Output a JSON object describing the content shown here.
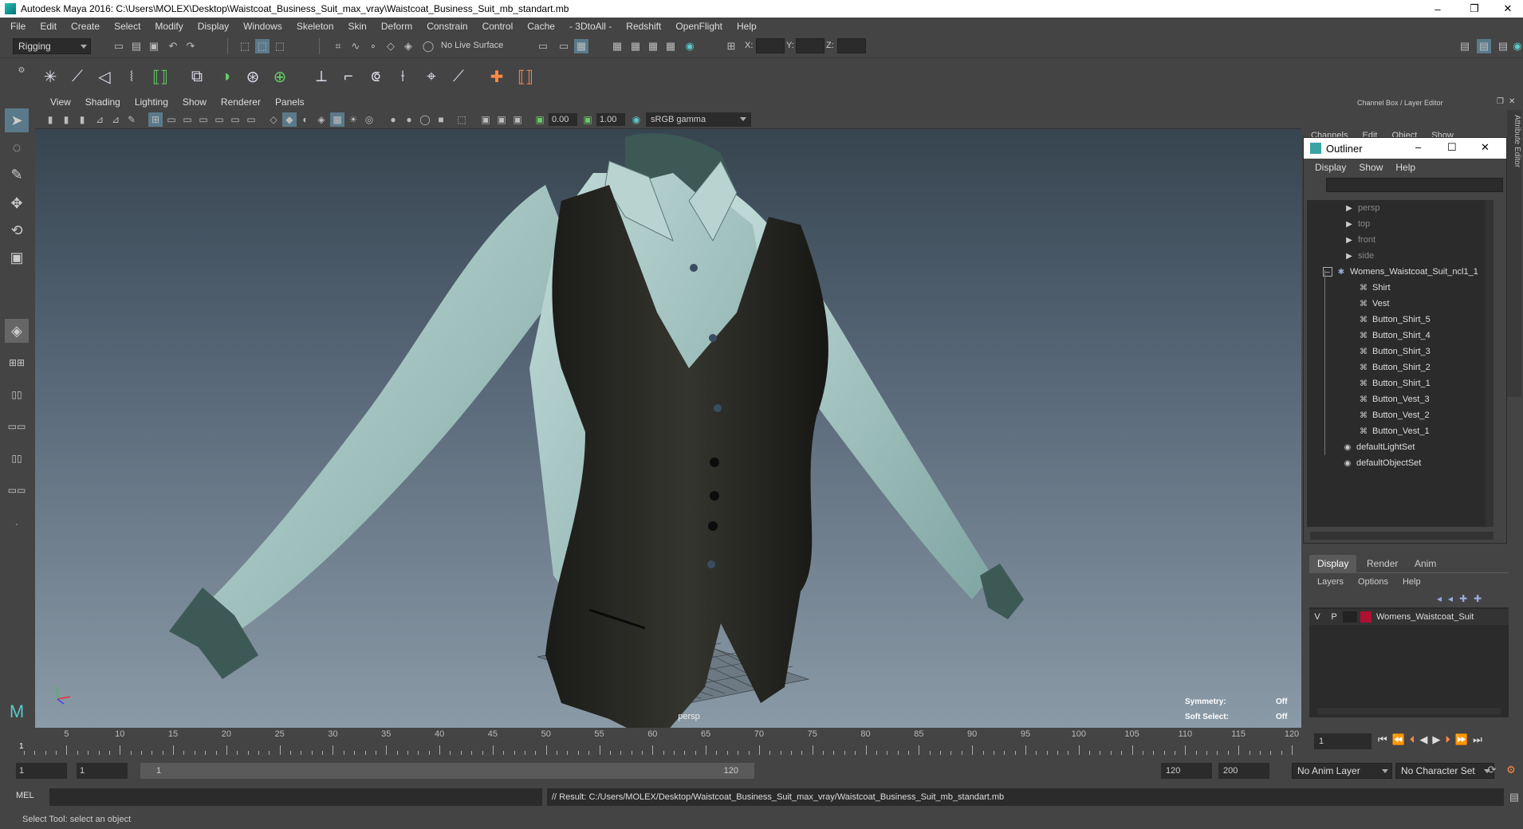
{
  "window": {
    "title": "Autodesk Maya 2016: C:\\Users\\MOLEX\\Desktop\\Waistcoat_Business_Suit_max_vray\\Waistcoat_Business_Suit_mb_standart.mb",
    "minimize": "–",
    "restore": "❐",
    "close": "✕"
  },
  "menubar": [
    "File",
    "Edit",
    "Create",
    "Select",
    "Modify",
    "Display",
    "Windows",
    "Skeleton",
    "Skin",
    "Deform",
    "Constrain",
    "Control",
    "Cache",
    "- 3DtoAll -",
    "Redshift",
    "OpenFlight",
    "Help"
  ],
  "status": {
    "menuset": "Rigging",
    "live_surface": "No Live Surface",
    "x_label": "X:",
    "y_label": "Y:",
    "z_label": "Z:"
  },
  "viewport": {
    "menus": [
      "View",
      "Shading",
      "Lighting",
      "Show",
      "Renderer",
      "Panels"
    ],
    "exposure": "0.00",
    "gamma": "1.00",
    "color_space": "sRGB gamma",
    "camera_label": "persp",
    "hud": [
      {
        "key": "Symmetry:",
        "value": "Off"
      },
      {
        "key": "Soft Select:",
        "value": "Off"
      }
    ]
  },
  "channel_box": {
    "title": "Channel Box / Layer Editor",
    "menus": [
      "Channels",
      "Edit",
      "Object",
      "Show"
    ]
  },
  "outliner": {
    "title": "Outliner",
    "menus": [
      "Display",
      "Show",
      "Help"
    ],
    "cameras": [
      "persp",
      "top",
      "front",
      "side"
    ],
    "group": "Womens_Waistcoat_Suit_ncl1_1",
    "children": [
      "Shirt",
      "Vest",
      "Button_Shirt_5",
      "Button_Shirt_4",
      "Button_Shirt_3",
      "Button_Shirt_2",
      "Button_Shirt_1",
      "Button_Vest_3",
      "Button_Vest_2",
      "Button_Vest_1"
    ],
    "sets": [
      "defaultLightSet",
      "defaultObjectSet"
    ]
  },
  "layer_editor": {
    "tabs": [
      "Display",
      "Render",
      "Anim"
    ],
    "menus": [
      "Layers",
      "Options",
      "Help"
    ],
    "layer": {
      "v": "V",
      "p": "P",
      "name": "Womens_Waistcoat_Suit",
      "color": "#b01030"
    }
  },
  "side_tabs": {
    "attribute": "Attribute Editor",
    "channel": "Channel Box / Layer Editor"
  },
  "timeline": {
    "ticks": [
      "5",
      "10",
      "15",
      "20",
      "25",
      "30",
      "35",
      "40",
      "45",
      "50",
      "55",
      "60",
      "65",
      "70",
      "75",
      "80",
      "85",
      "90",
      "95",
      "100",
      "105",
      "110",
      "115",
      "120"
    ],
    "start_marker": "1",
    "current_frame": "1"
  },
  "range": {
    "start": "1",
    "playback_start": "1",
    "slider_start": "1",
    "slider_end": "120",
    "playback_end": "120",
    "end": "200",
    "anim_layer": "No Anim Layer",
    "character_set": "No Character Set"
  },
  "command": {
    "lang": "MEL",
    "result": "// Result: C:/Users/MOLEX/Desktop/Waistcoat_Business_Suit_max_vray/Waistcoat_Business_Suit_mb_standart.mb"
  },
  "help_line": "Select Tool: select an object",
  "colors": {
    "ui_bg": "#444444",
    "field_bg": "#2b2b2b",
    "accent": "#5ac8c8",
    "shirt": "#a9c9c6",
    "vest": "#2a2a26"
  }
}
